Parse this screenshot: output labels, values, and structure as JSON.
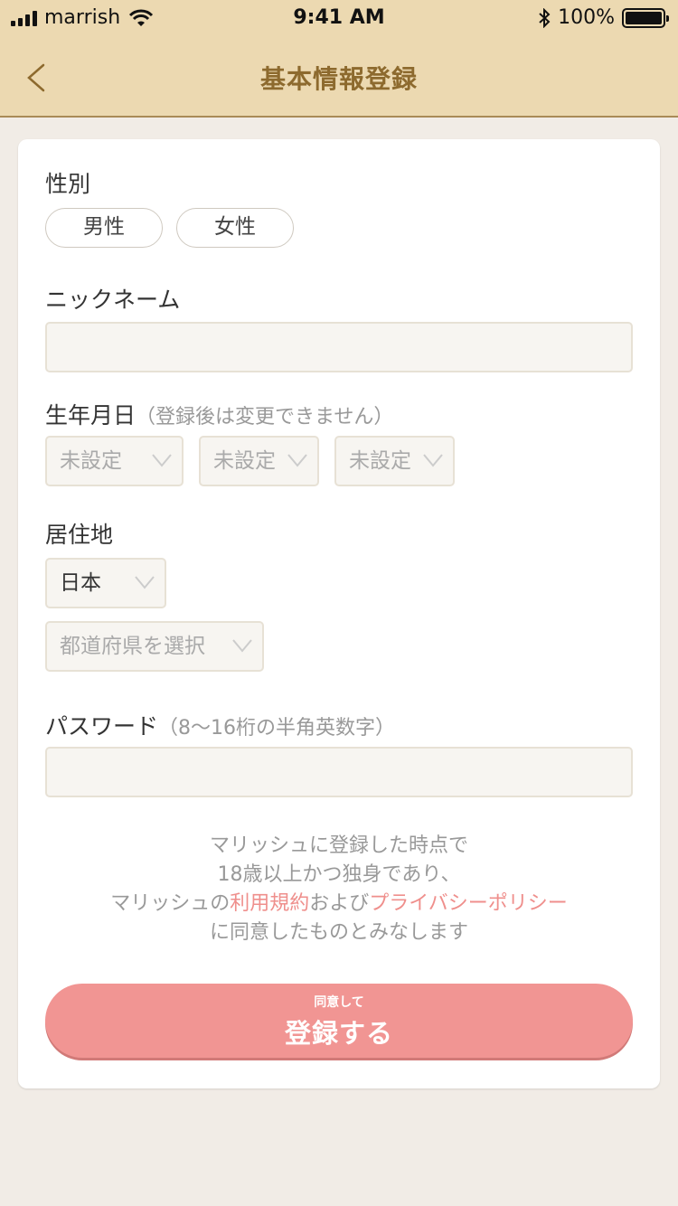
{
  "status_bar": {
    "carrier": "marrish",
    "time": "9:41 AM",
    "battery": "100%"
  },
  "nav": {
    "title": "基本情報登録",
    "back_icon": "chevron-left-icon"
  },
  "form": {
    "gender": {
      "label": "性別",
      "options": [
        "男性",
        "女性"
      ]
    },
    "nickname": {
      "label": "ニックネーム",
      "value": ""
    },
    "birthday": {
      "label": "生年月日",
      "note": "（登録後は変更できません）",
      "selects": [
        "未設定",
        "未設定",
        "未設定"
      ]
    },
    "residence": {
      "label": "居住地",
      "country": "日本",
      "prefecture_placeholder": "都道府県を選択"
    },
    "password": {
      "label": "パスワード",
      "note": "（8〜16桁の半角英数字）",
      "value": ""
    }
  },
  "agreement": {
    "line1": "マリッシュに登録した時点で",
    "line2": "18歳以上かつ独身であり、",
    "line3_prefix": "マリッシュの",
    "terms_link": "利用規約",
    "line3_mid": "および",
    "privacy_link": "プライバシーポリシー",
    "line4": "に同意したものとみなします"
  },
  "submit": {
    "sub_label": "同意して",
    "main_label": "登録する"
  },
  "colors": {
    "header_bg": "#ecd9b1",
    "title": "#8d6a2e",
    "accent": "#f19593",
    "link": "#ef8f8c",
    "page_bg": "#f1ece6"
  }
}
